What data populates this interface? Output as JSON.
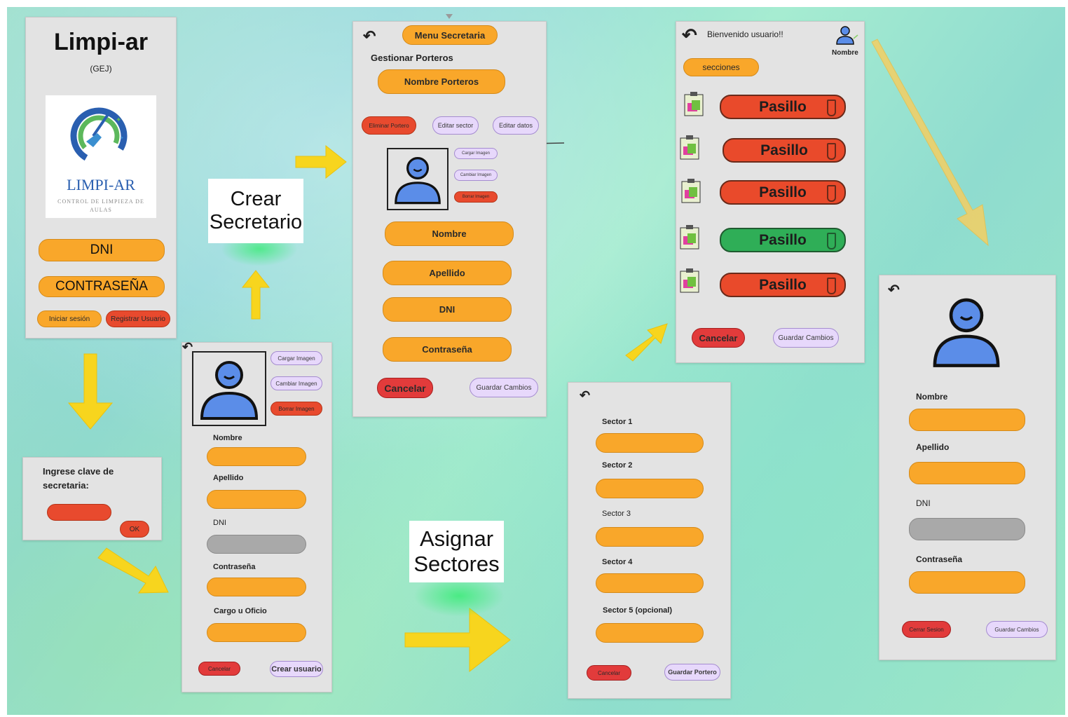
{
  "login": {
    "title": "Limpi-ar",
    "subtitle": "(GEJ)",
    "logo_name": "LIMPI-AR",
    "logo_tagline": "CONTROL DE LIMPIEZA DE AULAS",
    "dni": "DNI",
    "password": "CONTRASEÑA",
    "login_button": "Iniciar sesión",
    "register_button": "Registrar Usuario"
  },
  "secretary_key": {
    "prompt": "Ingrese clave de secretaria:",
    "ok": "OK"
  },
  "notes": {
    "crear_secretario": "Crear Secretario",
    "asignar_sectores": "Asignar Sectores"
  },
  "register_form": {
    "load_image": "Cargar Imagen",
    "change_image": "Cambiar Imagen",
    "delete_image": "Borrar Imagen",
    "nombre": "Nombre",
    "apellido": "Apellido",
    "dni": "DNI",
    "contrasena": "Contraseña",
    "cargo": "Cargo u Oficio",
    "cancel": "Cancelar",
    "create": "Crear usuario"
  },
  "secretary_menu": {
    "menu_title": "Menu Secretaria",
    "manage": "Gestionar Porteros",
    "porter_names": "Nombre Porteros",
    "delete_porter": "Eliminar Portero",
    "edit_sector": "Editar sector",
    "edit_data": "Editar datos",
    "load_image": "Cargar Imagen",
    "change_image": "Cambiar Imagen",
    "delete_image": "Borrar Imagen",
    "nombre": "Nombre",
    "apellido": "Apellido",
    "dni": "DNI",
    "contrasena": "Contraseña",
    "cancel": "Cancelar",
    "save": "Guardar Cambios"
  },
  "sectors": {
    "items": [
      "Sector 1",
      "Sector 2",
      "Sector 3",
      "Sector 4",
      "Sector 5 (opcional)"
    ],
    "cancel": "Cancelar",
    "save": "Guardar Portero"
  },
  "welcome": {
    "greeting": "Bienvenido usuario!!",
    "user_name": "Nombre",
    "sections_button": "secciones",
    "rows": [
      {
        "label": "Pasillo",
        "status_color": "#e94a2b"
      },
      {
        "label": "Pasillo",
        "status_color": "#e94a2b"
      },
      {
        "label": "Pasillo",
        "status_color": "#e94a2b"
      },
      {
        "label": "Pasillo",
        "status_color": "#2fae57"
      },
      {
        "label": "Pasillo",
        "status_color": "#e94a2b"
      }
    ],
    "cancel": "Cancelar",
    "save": "Guardar Cambios"
  },
  "profile": {
    "nombre": "Nombre",
    "apellido": "Apellido",
    "dni": "DNI",
    "contrasena": "Contraseña",
    "logout": "Cerrar Sesion",
    "save": "Guardar Cambios"
  },
  "colors": {
    "orange": "#f9a72a",
    "red": "#e84a2e",
    "green": "#2fae57",
    "lavender": "#e7d8fb",
    "arrow_yellow": "#f7d51e"
  }
}
